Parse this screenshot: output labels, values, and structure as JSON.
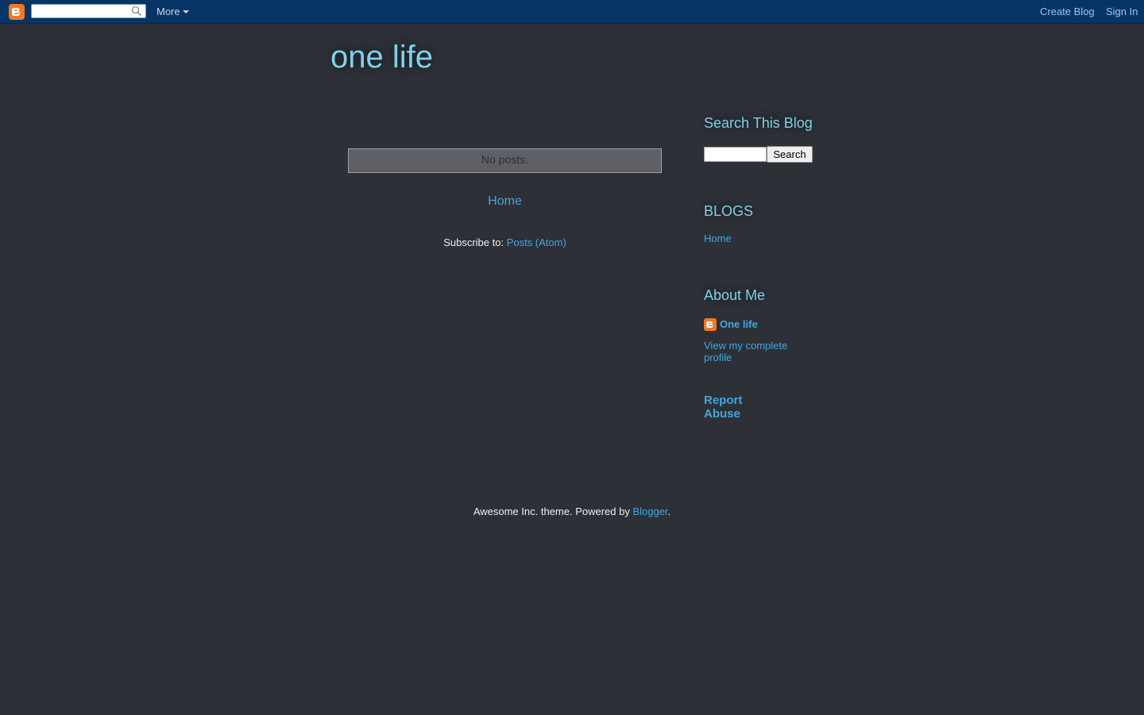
{
  "navbar": {
    "more_label": "More",
    "create_blog_label": "Create Blog",
    "sign_in_label": "Sign In",
    "search_value": ""
  },
  "blog": {
    "title": "one life"
  },
  "main": {
    "no_posts_text": "No posts.",
    "home_link": "Home",
    "subscribe_prefix": "Subscribe to: ",
    "subscribe_link": "Posts (Atom)"
  },
  "sidebar": {
    "search_title": "Search This Blog",
    "search_button": "Search",
    "search_value": "",
    "blogs_title": "BLOGS",
    "blogs_items": [
      "Home"
    ],
    "about_title": "About Me",
    "profile_name": "One life",
    "profile_link": "View my complete profile",
    "report_abuse": "Report Abuse"
  },
  "footer": {
    "prefix": "Awesome Inc. theme. Powered by ",
    "link": "Blogger",
    "suffix": "."
  },
  "colors": {
    "background": "#2d3037",
    "navbar": "#063566",
    "title": "#7fd1ea",
    "link": "#3fa8df",
    "blogger_orange": "#f27825"
  },
  "icons": {
    "navbar_logo": "blogger-logo-icon",
    "navbar_search": "search-icon",
    "profile": "blogger-profile-icon"
  }
}
